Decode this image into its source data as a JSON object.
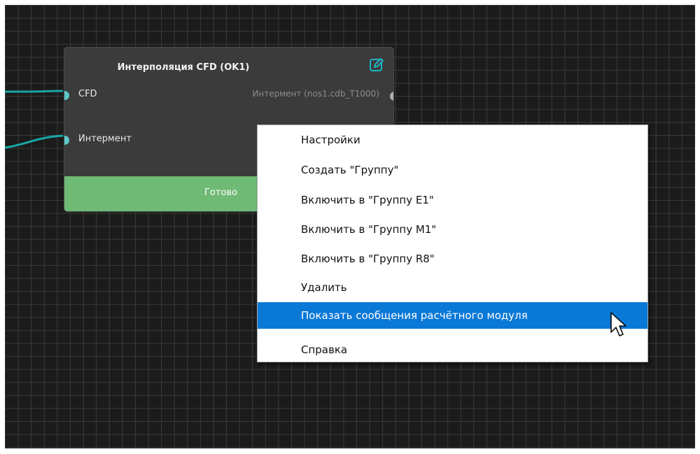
{
  "colors": {
    "canvas_background": "#1b1b1b",
    "grid_line": "#3a3a3a",
    "node_background": "#3b3b3b",
    "node_status_background": "#6fba74",
    "connection_wire": "#19a6a6",
    "port_connected": "#5ec8c8",
    "port_unconnected": "#b0b0b0",
    "edit_icon": "#1fb5c8",
    "menu_highlight": "#0a78d7"
  },
  "node": {
    "title": "Интерполяция CFD (OK1)",
    "edit_icon": "edit-icon",
    "inputs": [
      {
        "label": "CFD"
      },
      {
        "label": "Интермент"
      }
    ],
    "output": {
      "label": "Интермент (nos1.cdb_T1000)"
    },
    "status": "Готово"
  },
  "context_menu": {
    "items": [
      {
        "label": "Настройки",
        "highlighted": false
      },
      {
        "label": "Создать \"Группу\"",
        "highlighted": false
      },
      {
        "label": "Включить в \"Группу E1\"",
        "highlighted": false
      },
      {
        "label": "Включить в \"Группу M1\"",
        "highlighted": false
      },
      {
        "label": "Включить в \"Группу R8\"",
        "highlighted": false
      },
      {
        "label": "Удалить",
        "highlighted": false
      },
      {
        "label": "Показать сообщения расчётного модуля",
        "highlighted": true
      },
      {
        "label": "Справка",
        "highlighted": false
      }
    ]
  },
  "cursor": {
    "icon": "arrow-cursor-icon"
  }
}
